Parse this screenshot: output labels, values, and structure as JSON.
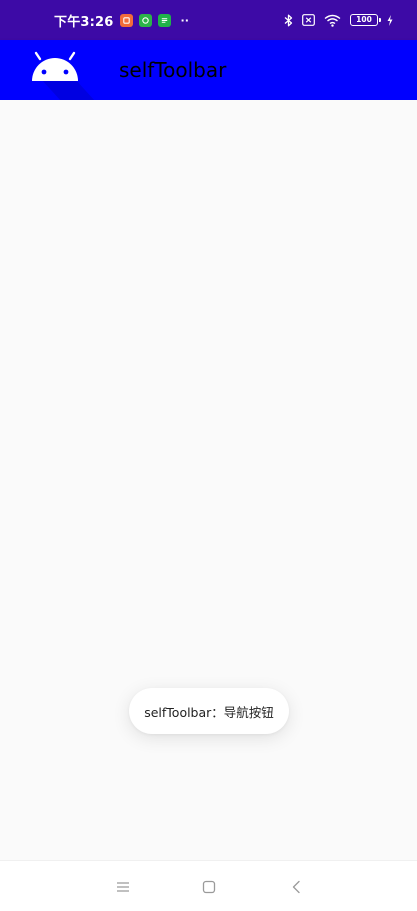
{
  "status_bar": {
    "time": "下午3:26",
    "battery_level": "100",
    "dots": "··",
    "background": "#3d0aa6",
    "notif_icons": [
      "orange-app-icon",
      "green-app-icon",
      "green-app-icon-2"
    ],
    "right_icons": [
      "bluetooth-icon",
      "sim-disabled-icon",
      "wifi-icon",
      "battery-icon",
      "charging-icon"
    ]
  },
  "toolbar": {
    "title": "selfToolbar",
    "background": "#0000ff",
    "nav_icon": "android-logo-icon"
  },
  "toast": {
    "message": "selfToolbar：导航按钮"
  },
  "bottom_nav": {
    "buttons": [
      "menu-icon",
      "home-icon",
      "back-icon"
    ]
  }
}
